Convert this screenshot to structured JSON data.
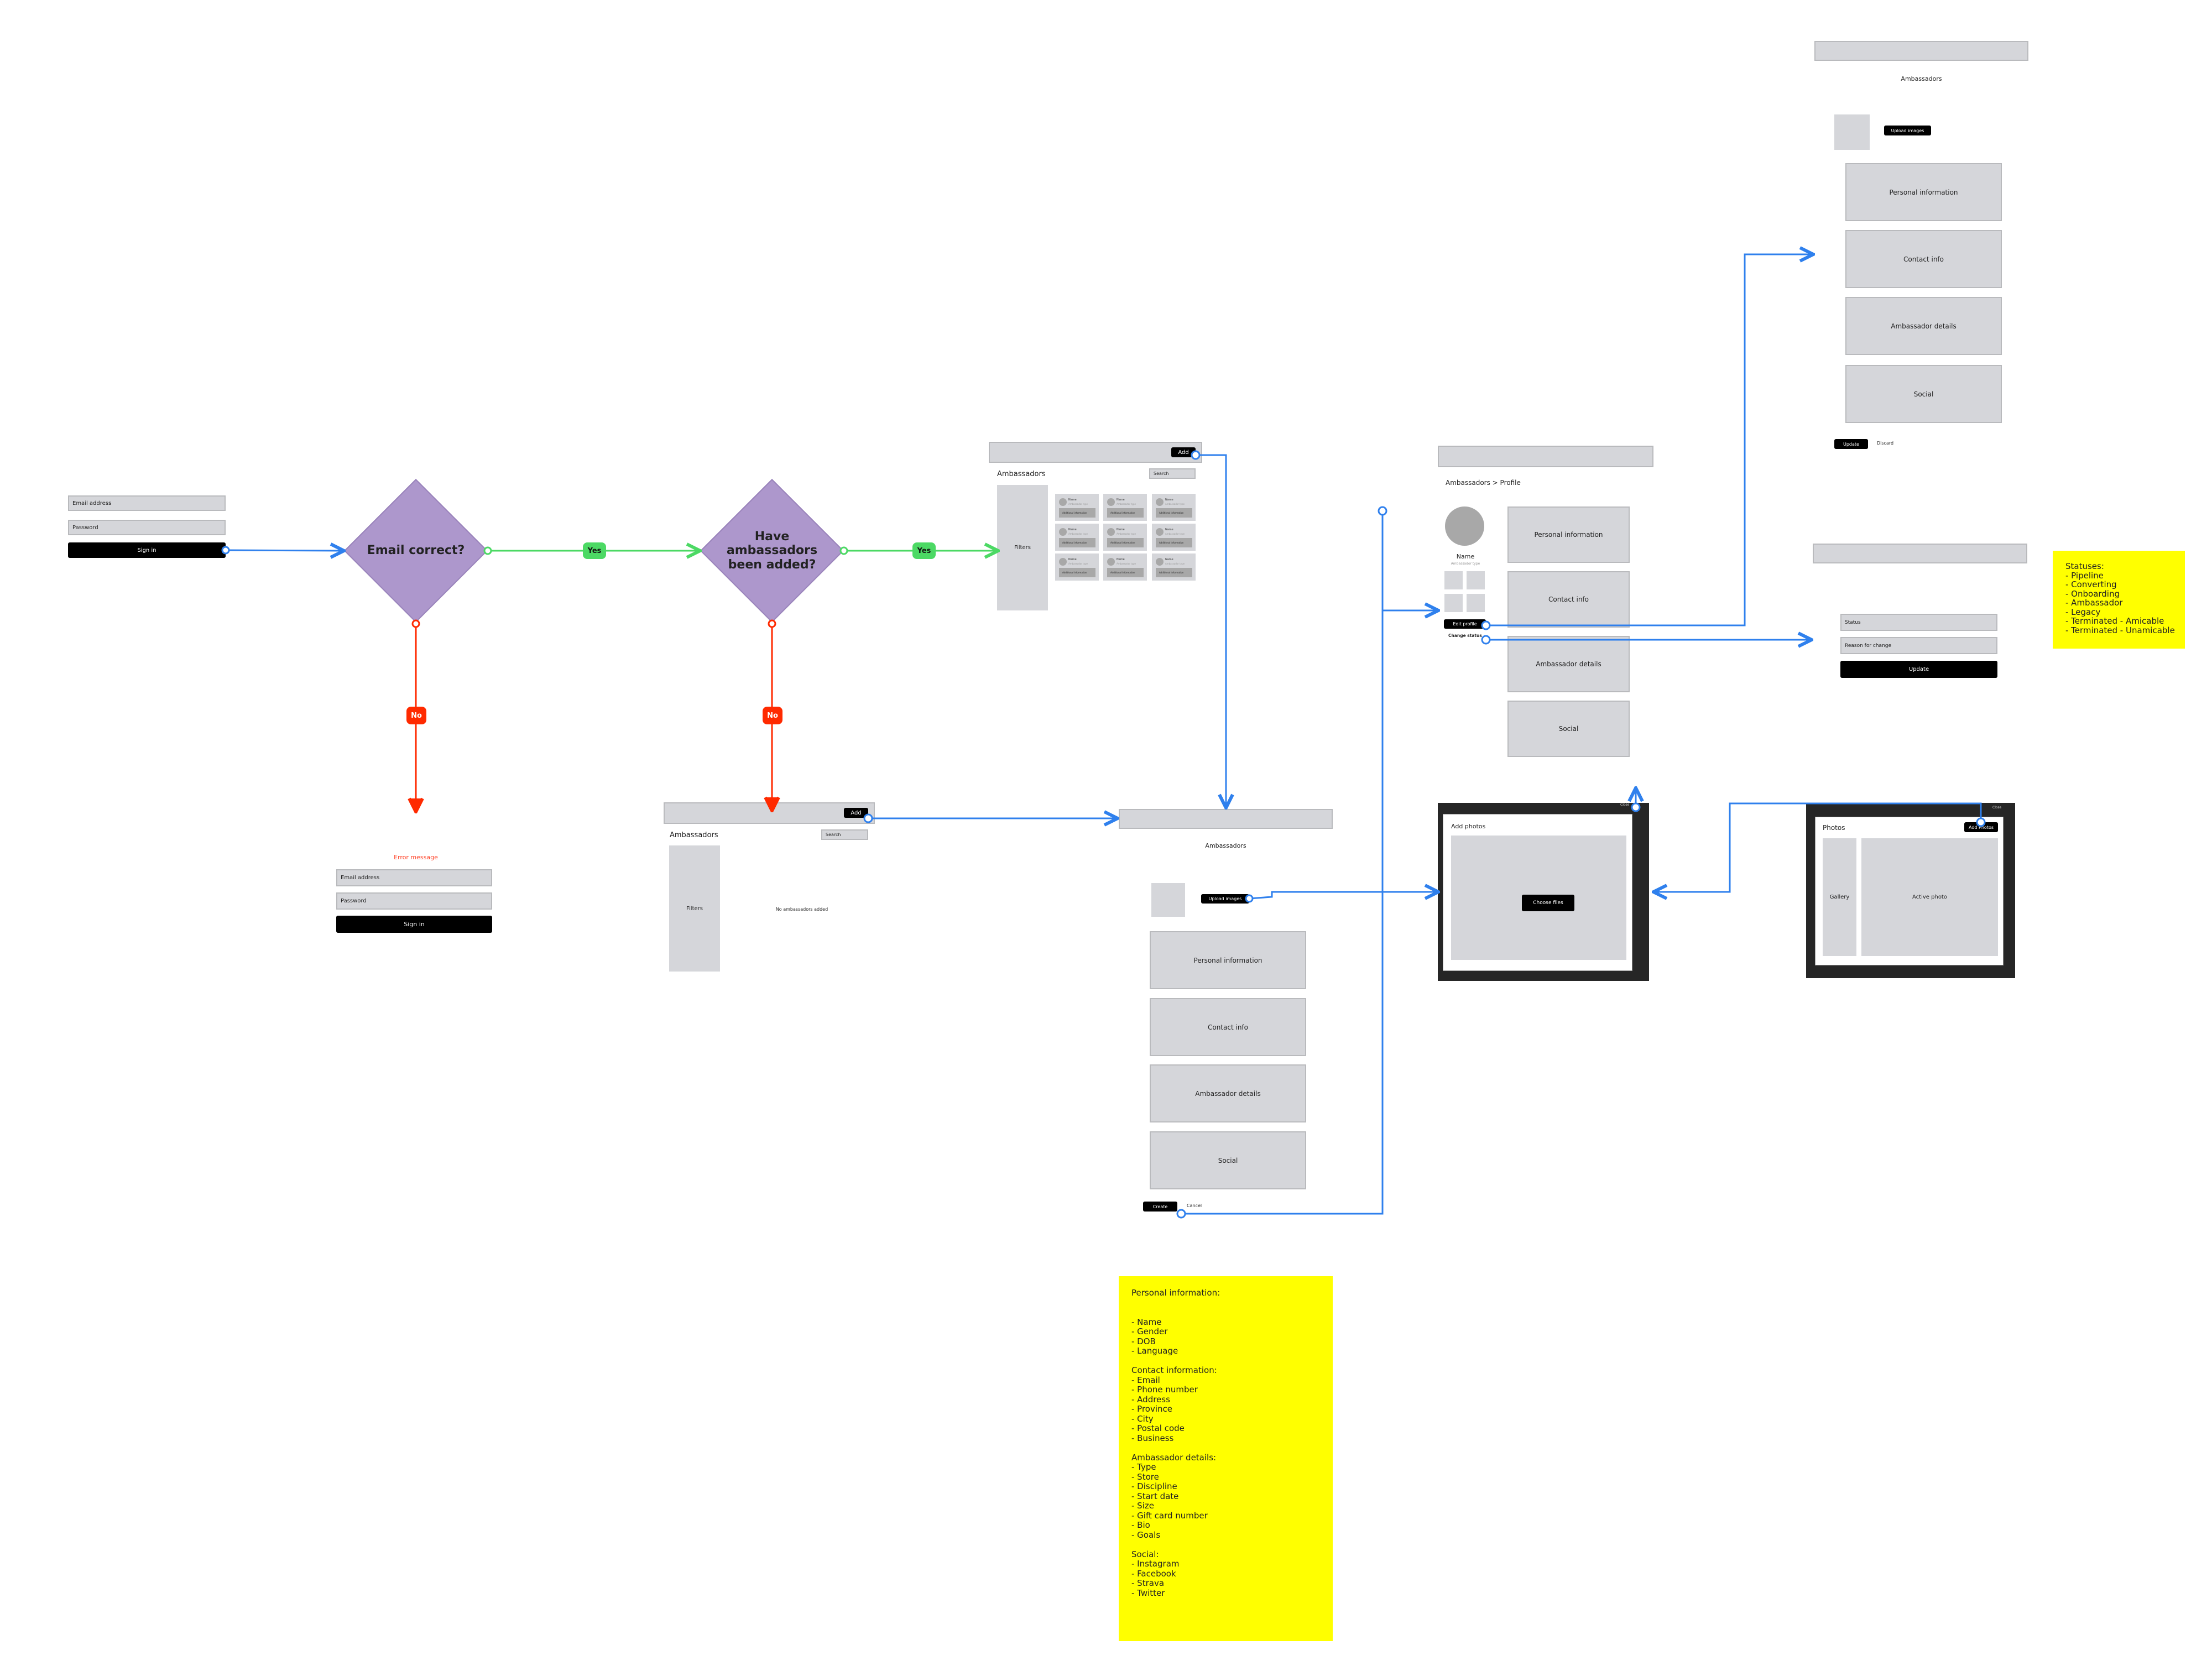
{
  "colors": {
    "connector_blue": "#2f80ed",
    "connector_green": "#4cd964",
    "connector_red": "#ff2a00",
    "decision": "#ad97cc",
    "note": "#ffff00",
    "wire_gray": "#d5d6da"
  },
  "login": {
    "email_placeholder": "Email address",
    "password_placeholder": "Password",
    "signin_label": "Sign in"
  },
  "login_error": {
    "error_message": "Error message",
    "email_placeholder": "Email address",
    "password_placeholder": "Password",
    "signin_label": "Sign in"
  },
  "decisions": [
    {
      "label": "Email correct?",
      "yes": "Yes",
      "no": "No"
    },
    {
      "label": "Have ambassadors been added?",
      "yes": "Yes",
      "no": "No"
    }
  ],
  "ambassador_list": {
    "add_label": "Add",
    "title": "Ambassadors",
    "search_placeholder": "Search",
    "filters_label": "Filters",
    "cards": [
      {
        "name": "Name",
        "type": "Ambassador type",
        "info": "Additional information"
      },
      {
        "name": "Name",
        "type": "Ambassador type",
        "info": "Additional information"
      },
      {
        "name": "Name",
        "type": "Ambassador type",
        "info": "Additional information"
      },
      {
        "name": "Name",
        "type": "Ambassador type",
        "info": "Additional information"
      },
      {
        "name": "Name",
        "type": "Ambassador type",
        "info": "Additional information"
      },
      {
        "name": "Name",
        "type": "Ambassador type",
        "info": "Additional information"
      },
      {
        "name": "Name",
        "type": "Ambassador type",
        "info": "Additional information"
      },
      {
        "name": "Name",
        "type": "Ambassador type",
        "info": "Additional information"
      },
      {
        "name": "Name",
        "type": "Ambassador type",
        "info": "Additional information"
      }
    ]
  },
  "ambassador_empty": {
    "add_label": "Add",
    "title": "Ambassadors",
    "search_placeholder": "Search",
    "filters_label": "Filters",
    "empty_message": "No ambassadors added"
  },
  "create_ambassador": {
    "title": "Ambassadors",
    "upload_label": "Upload images",
    "sections": [
      "Personal information",
      "Contact info",
      "Ambassador details",
      "Social"
    ],
    "create_label": "Create",
    "cancel_label": "Cancel"
  },
  "profile": {
    "breadcrumb": "Ambassadors > Profile",
    "name": "Name",
    "type": "Ambassador type",
    "sections": [
      "Personal information",
      "Contact info",
      "Ambassador details",
      "Social"
    ],
    "edit_label": "Edit profile",
    "change_status_label": "Change status"
  },
  "edit_profile": {
    "title": "Ambassadors",
    "upload_label": "Upload images",
    "sections": [
      "Personal information",
      "Contact info",
      "Ambassador details",
      "Social"
    ],
    "update_label": "Update",
    "discard_label": "Discard"
  },
  "change_status": {
    "status_placeholder": "Status",
    "reason_placeholder": "Reason for change",
    "update_label": "Update"
  },
  "statuses_note": {
    "text": "Statuses:\n- Pipeline\n- Converting\n- Onboarding\n- Ambassador\n- Legacy\n- Terminated - Amicable\n- Terminated - Unamicable"
  },
  "fields_note": {
    "text": "Personal information:\n\n\n- Name\n- Gender\n- DOB\n- Language\n\nContact information:\n- Email\n- Phone number\n- Address\n- Province\n- City\n- Postal code\n- Business\n\nAmbassador details:\n- Type\n- Store\n- Discipline\n- Start date\n- Size\n- Gift card number\n- Bio\n- Goals\n\nSocial:\n- Instagram\n- Facebook\n- Strava\n- Twitter"
  },
  "add_photos_modal": {
    "close_label": "Close",
    "title": "Add photos",
    "choose_label": "Choose files"
  },
  "photos_modal": {
    "close_label": "Close",
    "title": "Photos",
    "add_label": "Add Photos",
    "gallery_label": "Gallery",
    "active_label": "Active photo"
  }
}
